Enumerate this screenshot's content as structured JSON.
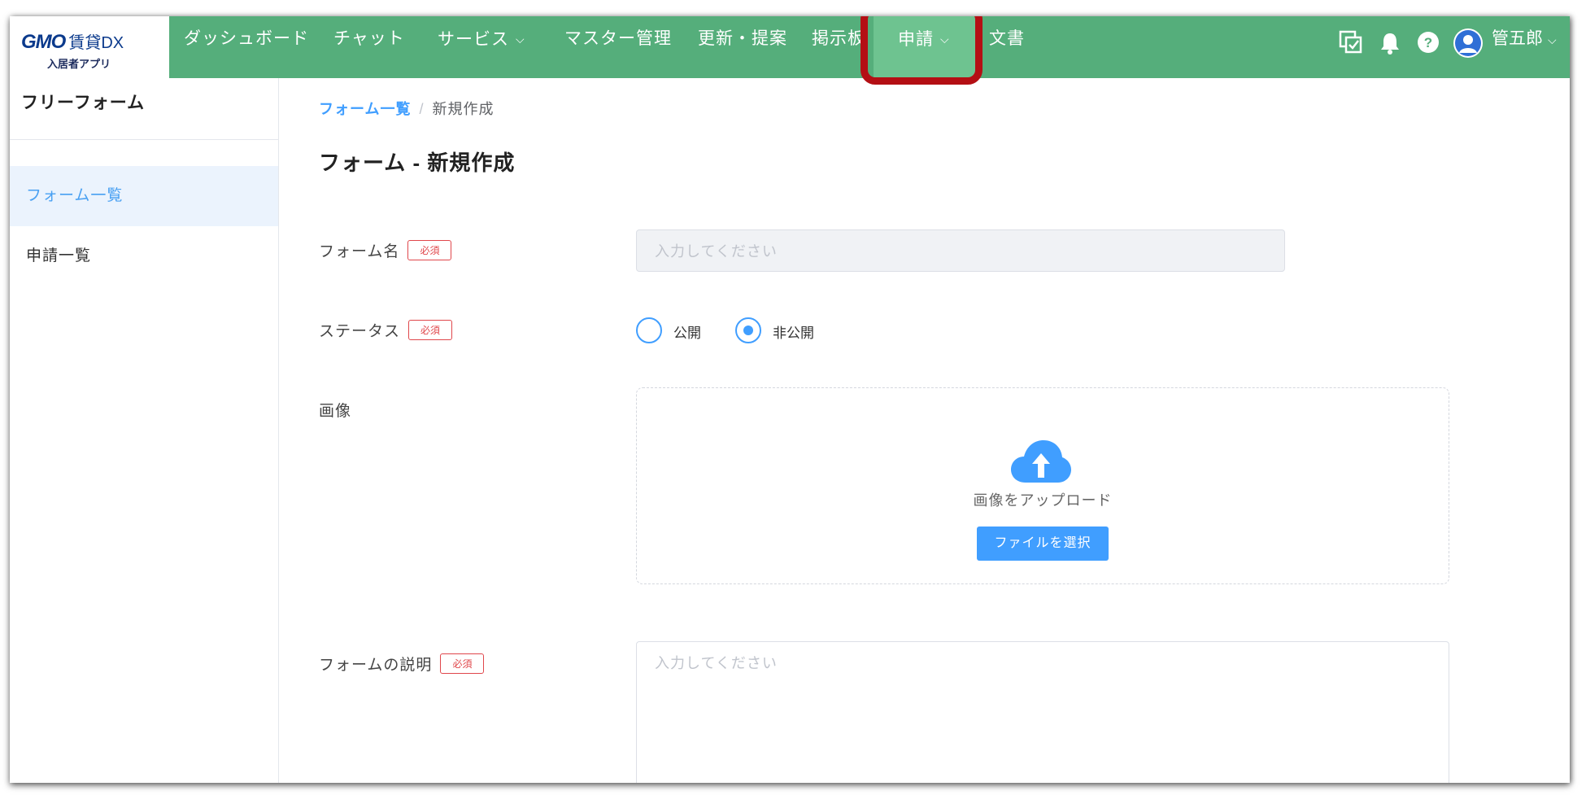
{
  "header": {
    "logo_brand": "GMO",
    "logo_service": "賃貸DX",
    "logo_sub": "入居者アプリ",
    "nav": [
      {
        "label": "ダッシュボード",
        "dropdown": false
      },
      {
        "label": "チャット",
        "dropdown": false
      },
      {
        "label": "サービス",
        "dropdown": true
      },
      {
        "label": "マスター管理",
        "dropdown": false
      },
      {
        "label": "更新・提案",
        "dropdown": false
      },
      {
        "label": "掲示板",
        "dropdown": false
      },
      {
        "label": "申請",
        "dropdown": true,
        "active": true
      },
      {
        "label": "文書",
        "dropdown": false
      }
    ],
    "chevron": "⌵",
    "user_name": "管五郎",
    "icons": [
      "tasks-icon",
      "bell-icon",
      "help-icon",
      "avatar-icon"
    ],
    "colors": {
      "bar": "#55ae7b",
      "active": "#6ec390",
      "highlight": "#b40f14"
    }
  },
  "sidebar": {
    "title": "フリーフォーム",
    "items": [
      {
        "label": "フォーム一覧",
        "active": true
      },
      {
        "label": "申請一覧",
        "active": false
      }
    ]
  },
  "breadcrumb": {
    "link": "フォーム一覧",
    "separator": "/",
    "current": "新規作成"
  },
  "page_title": "フォーム - 新規作成",
  "form": {
    "required_badge": "必須",
    "name": {
      "label": "フォーム名",
      "placeholder": "入力してください",
      "value": ""
    },
    "status": {
      "label": "ステータス",
      "options": [
        {
          "label": "公開",
          "checked": false
        },
        {
          "label": "非公開",
          "checked": true
        }
      ]
    },
    "image": {
      "label": "画像",
      "upload_text": "画像をアップロード",
      "button_label": "ファイルを選択",
      "icon": "cloud-upload-icon"
    },
    "description": {
      "label": "フォームの説明",
      "placeholder": "入力してください",
      "value": ""
    }
  },
  "accent": "#409eff"
}
